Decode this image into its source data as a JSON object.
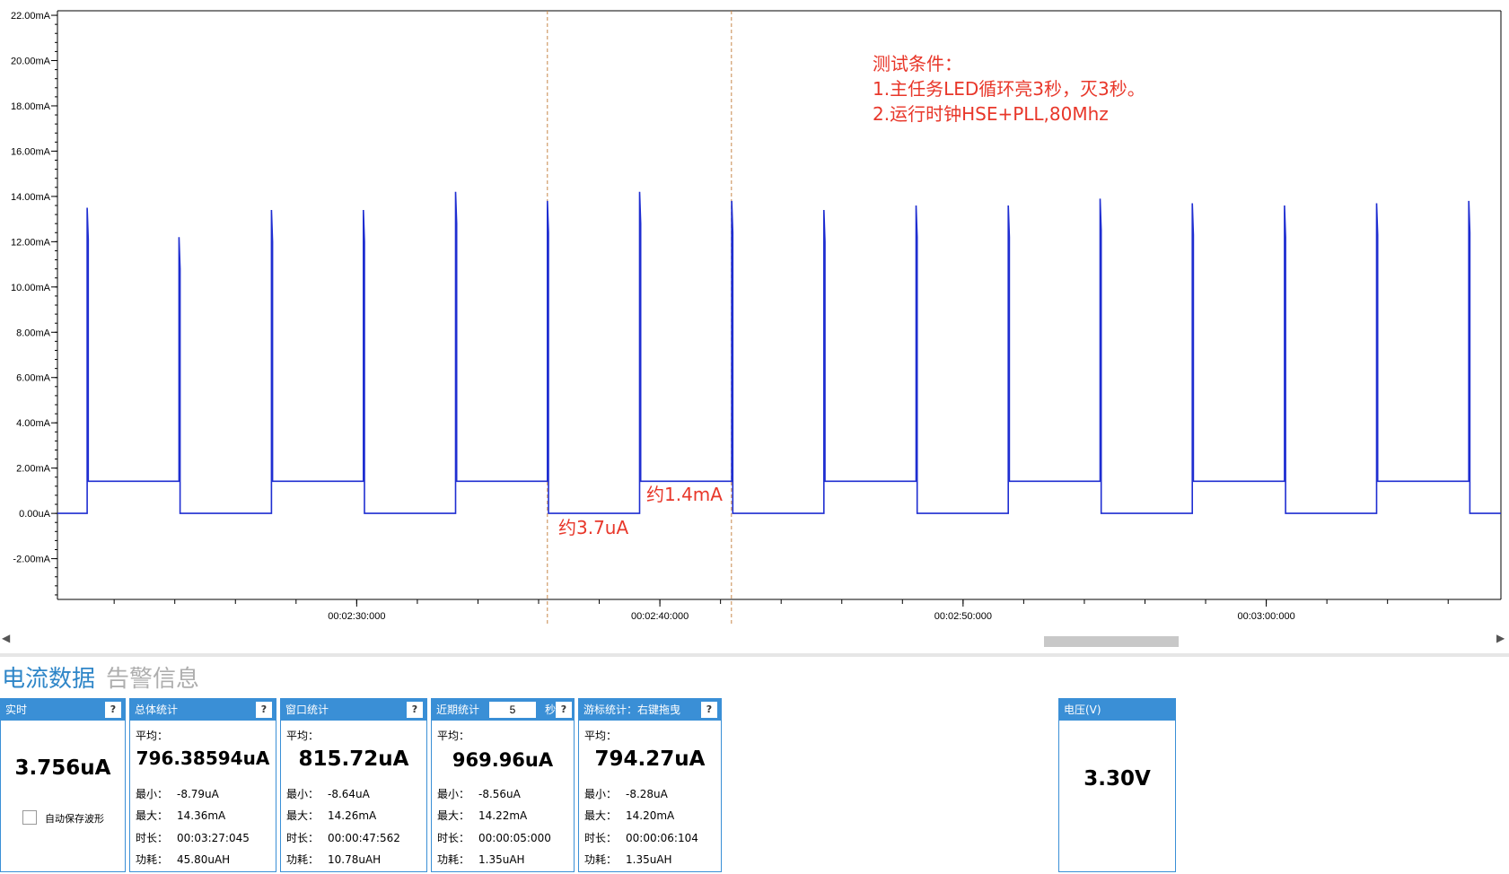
{
  "chart_data": {
    "type": "line",
    "yunit": "mA",
    "y_ticks": [
      {
        "v": 22,
        "label": "22.00mA"
      },
      {
        "v": 20,
        "label": "20.00mA"
      },
      {
        "v": 18,
        "label": "18.00mA"
      },
      {
        "v": 16,
        "label": "16.00mA"
      },
      {
        "v": 14,
        "label": "14.00mA"
      },
      {
        "v": 12,
        "label": "12.00mA"
      },
      {
        "v": 10,
        "label": "10.00mA"
      },
      {
        "v": 8,
        "label": "8.00mA"
      },
      {
        "v": 6,
        "label": "6.00mA"
      },
      {
        "v": 4,
        "label": "4.00mA"
      },
      {
        "v": 2,
        "label": "2.00mA"
      },
      {
        "v": 0,
        "label": "0.00uA"
      },
      {
        "v": -2,
        "label": "-2.00mA"
      }
    ],
    "ylim": [
      -3.8,
      22.2
    ],
    "x_ticks": [
      {
        "t": "00:02:30",
        "label": "00:02:30:000"
      },
      {
        "t": "00:02:40",
        "label": "00:02:40:000"
      },
      {
        "t": "00:02:50",
        "label": "00:02:50:000"
      },
      {
        "t": "00:03:00",
        "label": "00:03:00:000"
      }
    ],
    "xlim": [
      "00:02:20.13",
      "00:03:07.74"
    ],
    "grid": false,
    "high_level_mA": 1.42,
    "low_level_mA": 0.0037,
    "edges": [
      {
        "t": "00:02:21.11",
        "spike_mA": 13.5
      },
      {
        "t": "00:02:24.14",
        "spike_mA": 12.2
      },
      {
        "t": "00:02:27.19",
        "spike_mA": 13.4
      },
      {
        "t": "00:02:30.22",
        "spike_mA": 13.4
      },
      {
        "t": "00:02:33.26",
        "spike_mA": 14.2
      },
      {
        "t": "00:02:36.29",
        "spike_mA": 13.8
      },
      {
        "t": "00:02:39.33",
        "spike_mA": 14.2
      },
      {
        "t": "00:02:42.37",
        "spike_mA": 13.8
      },
      {
        "t": "00:02:45.41",
        "spike_mA": 13.4
      },
      {
        "t": "00:02:48.45",
        "spike_mA": 13.6
      },
      {
        "t": "00:02:51.49",
        "spike_mA": 13.6
      },
      {
        "t": "00:02:54.52",
        "spike_mA": 13.9
      },
      {
        "t": "00:02:57.56",
        "spike_mA": 13.7
      },
      {
        "t": "00:03:00.60",
        "spike_mA": 13.6
      },
      {
        "t": "00:03:03.64",
        "spike_mA": 13.7
      },
      {
        "t": "00:03:06.68",
        "spike_mA": 13.8
      }
    ],
    "starts_high": false,
    "cursors": [
      "00:02:36.29",
      "00:02:42.36"
    ],
    "annotations": {
      "lines": [
        "测试条件：",
        "1.主任务LED循环亮3秒，灭3秒。",
        "2.运行时钟HSE+PLL,80Mhz"
      ],
      "high_label": "约1.4mA",
      "low_label": "约3.7uA"
    },
    "colors": {
      "trace": "#1f2ed1",
      "annotation": "#e8372a",
      "cursor": "#c8884a",
      "axis": "#000000"
    }
  },
  "tabs": {
    "current": "电流数据",
    "alarm": "告警信息"
  },
  "help_label": "?",
  "labels": {
    "avg": "平均：",
    "min": "最小：",
    "max": "最大：",
    "duration": "时长：",
    "energy": "功耗："
  },
  "realtime": {
    "title": "实时",
    "value": "3.756uA",
    "autosave_label": "自动保存波形"
  },
  "overall": {
    "title": "总体统计",
    "avg": "796.38594uA",
    "min": "-8.79uA",
    "max": "14.36mA",
    "duration": "00:03:27:045",
    "energy": "45.80uAH"
  },
  "window": {
    "title": "窗口统计",
    "avg": "815.72uA",
    "min": "-8.64uA",
    "max": "14.26mA",
    "duration": "00:00:47:562",
    "energy": "10.78uAH"
  },
  "recent": {
    "title": "近期统计",
    "seconds": "5",
    "unit": "秒",
    "avg": "969.96uA",
    "min": "-8.56uA",
    "max": "14.22mA",
    "duration": "00:00:05:000",
    "energy": "1.35uAH"
  },
  "cursor_stats": {
    "title": "游标统计：右键拖曳",
    "avg": "794.27uA",
    "min": "-8.28uA",
    "max": "14.20mA",
    "duration": "00:00:06:104",
    "energy": "1.35uAH"
  },
  "voltage": {
    "title": "电压(V)",
    "value": "3.30V"
  }
}
